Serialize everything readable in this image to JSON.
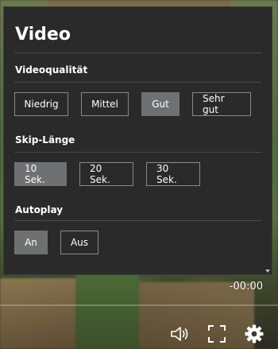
{
  "panel": {
    "title": "Video",
    "sections": [
      {
        "title": "Videoqualität",
        "options": [
          "Niedrig",
          "Mittel",
          "Gut",
          "Sehr gut"
        ],
        "selected": "Gut"
      },
      {
        "title": "Skip-Länge",
        "options": [
          "10 Sek.",
          "20 Sek.",
          "30 Sek."
        ],
        "selected": "10 Sek."
      },
      {
        "title": "Autoplay",
        "options": [
          "An",
          "Aus"
        ],
        "selected": "An"
      }
    ]
  },
  "player": {
    "time_remaining": "-00:00",
    "icons": [
      "volume-icon",
      "fullscreen-icon",
      "settings-gear-icon"
    ]
  },
  "colors": {
    "panel_bg": "#2a2a2a",
    "selected_bg": "#6f7072",
    "text": "#ffffff"
  }
}
